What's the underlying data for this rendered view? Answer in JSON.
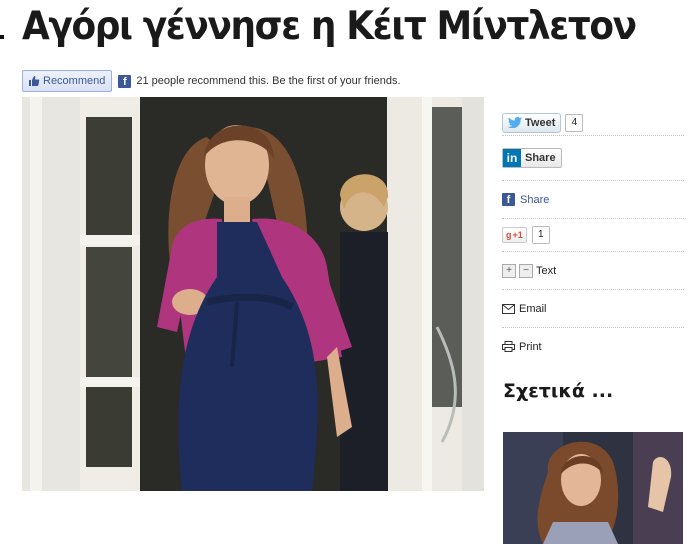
{
  "article": {
    "title": "Αγόρι γέννησε η Κέιτ Μίντλετον"
  },
  "facebook": {
    "recommend_label": "Recommend",
    "social_text": "21 people recommend this. Be the first of your friends."
  },
  "share": {
    "tweet_label": "Tweet",
    "tweet_count": "4",
    "linkedin_label": "Share",
    "facebook_label": "Share",
    "gplus_label": "+1",
    "gplus_count": "1",
    "text_size_plus": "+",
    "text_size_minus": "−",
    "text_label": "Text",
    "email_label": "Email",
    "print_label": "Print"
  },
  "related": {
    "heading": "Σχετικά ..."
  },
  "colors": {
    "facebook_blue": "#3b5998",
    "linkedin_blue": "#0077b5",
    "twitter_blue": "#55acee",
    "gplus_red": "#dd4b39",
    "cardigan_magenta": "#b0357f",
    "dress_navy": "#1f2d5c"
  },
  "icons": [
    "thumbs-up-icon",
    "facebook-icon",
    "twitter-bird-icon",
    "linkedin-icon",
    "gplus-icon",
    "plus-icon",
    "minus-icon",
    "envelope-icon",
    "printer-icon"
  ]
}
